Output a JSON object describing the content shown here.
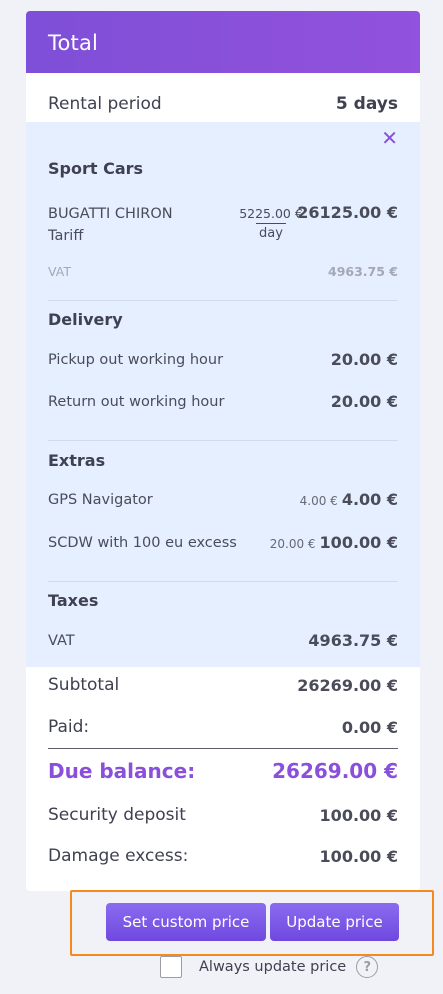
{
  "header": {
    "title": "Total"
  },
  "rental": {
    "label": "Rental period",
    "value": "5 days"
  },
  "sport_cars": {
    "title": "Sport Cars",
    "item_line1": "BUGATTI CHIRON",
    "item_line2": "Tariff",
    "rate": "5225.00 €",
    "rate_unit": "day",
    "total": "26125.00 €",
    "vat_label": "VAT",
    "vat_value": "4963.75 €"
  },
  "delivery": {
    "title": "Delivery",
    "items": [
      {
        "label": "Pickup out working hour",
        "value": "20.00 €"
      },
      {
        "label": "Return out working hour",
        "value": "20.00 €"
      }
    ]
  },
  "extras": {
    "title": "Extras",
    "items": [
      {
        "label": "GPS Navigator",
        "rate": "4.00 €",
        "value": "4.00 €"
      },
      {
        "label": "SCDW with 100 eu excess",
        "rate": "20.00 €",
        "value": "100.00 €"
      }
    ]
  },
  "taxes": {
    "title": "Taxes",
    "items": [
      {
        "label": "VAT",
        "value": "4963.75 €"
      }
    ]
  },
  "summary": {
    "subtotal_label": "Subtotal",
    "subtotal_value": "26269.00 €",
    "paid_label": "Paid:",
    "paid_value": "0.00 €",
    "due_label": "Due balance:",
    "due_value": "26269.00 €",
    "deposit_label": "Security deposit",
    "deposit_value": "100.00 €",
    "excess_label": "Damage excess:",
    "excess_value": "100.00 €"
  },
  "actions": {
    "custom_price": "Set custom price",
    "update_price": "Update price",
    "always_update": "Always update price",
    "help_glyph": "?"
  },
  "icons": {
    "close": "close-icon",
    "help": "help-icon"
  },
  "colors": {
    "accent": "#8a4fdb",
    "highlight": "#f58a1f",
    "details_bg": "#e6efff"
  }
}
